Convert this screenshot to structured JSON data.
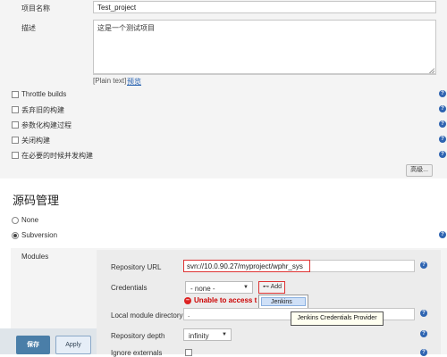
{
  "project": {
    "name_label": "项目名称",
    "name_value": "Test_project",
    "desc_label": "描述",
    "desc_value": "这是一个测试项目",
    "plain_text": "[Plain text]",
    "preview_link": "预览"
  },
  "options": [
    {
      "label": "Throttle builds"
    },
    {
      "label": "丢弃旧的构建"
    },
    {
      "label": "参数化构建过程"
    },
    {
      "label": "关闭构建"
    },
    {
      "label": "在必要的时候并发构建"
    }
  ],
  "advanced_label": "高级...",
  "scm": {
    "title": "源码管理",
    "none_label": "None",
    "svn_label": "Subversion",
    "modules_label": "Modules",
    "repo_url_label": "Repository URL",
    "repo_url_value": "svn://10.0.90.27/myproject/wphr_sys",
    "credentials_label": "Credentials",
    "credentials_value": "- none -",
    "add_label": "Add",
    "dropdown_item": "Jenkins",
    "error_text": "Unable to access t",
    "local_dir_label": "Local module directory",
    "local_dir_value": ".",
    "tooltip": "Jenkins Credentials Provider",
    "depth_label": "Repository depth",
    "depth_value": "infinity",
    "ignore_label": "Ignore externals"
  },
  "buttons": {
    "save": "保存",
    "apply": "Apply"
  },
  "colors": {
    "accent": "#4a7ea8",
    "error": "#cc0000",
    "help": "#2e64b1"
  }
}
